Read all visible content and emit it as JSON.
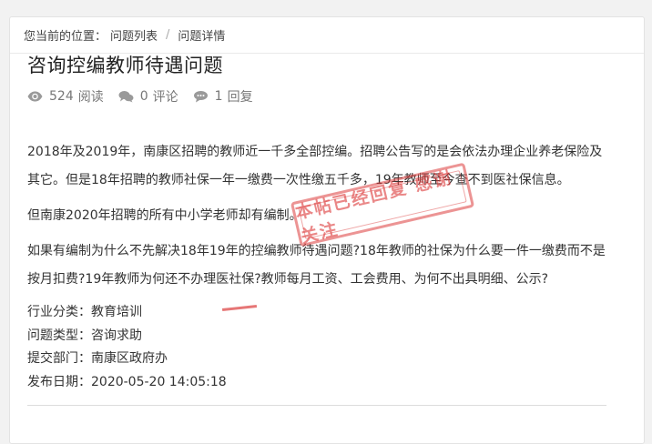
{
  "breadcrumb": {
    "prefix": "您当前的位置：",
    "items": [
      "问题列表",
      "问题详情"
    ],
    "separator": "/"
  },
  "question": {
    "title": "咨询控编教师待遇问题",
    "stats": {
      "views": "524",
      "views_label": "阅读",
      "comments": "0",
      "comments_label": "评论",
      "replies": "1",
      "replies_label": "回复"
    },
    "paragraphs": [
      "2018年及2019年，南康区招聘的教师近一千多全部控编。招聘公告写的是会依法办理企业养老保险及其它。但是18年招聘的教师社保一年一缴费一次性缴五千多，19年教师至今查不到医社保信息。",
      "但南康2020年招聘的所有中小学老师却有编制。",
      "如果有编制为什么不先解决18年19年的控编教师待遇问题?18年教师的社保为什么要一件一缴费而不是按月扣费?19年教师为何还不办理医社保?教师每月工资、工会费用、为何不出具明细、公示?"
    ],
    "info": {
      "industry_label": "行业分类：",
      "industry": "教育培训",
      "type_label": "问题类型：",
      "type": "咨询求助",
      "dept_label": "提交部门：",
      "dept": "南康区政府办",
      "date_label": "发布日期：",
      "date": "2020-05-20 14:05:18"
    },
    "stamp_text": "本帖已经回复 感谢关注"
  },
  "icons": {
    "views": "eye-icon",
    "comments": "comment-bubbles-icon",
    "replies": "reply-bubble-icon"
  },
  "colors": {
    "stamp": "#dc3c3c",
    "meta_text": "#777777"
  }
}
